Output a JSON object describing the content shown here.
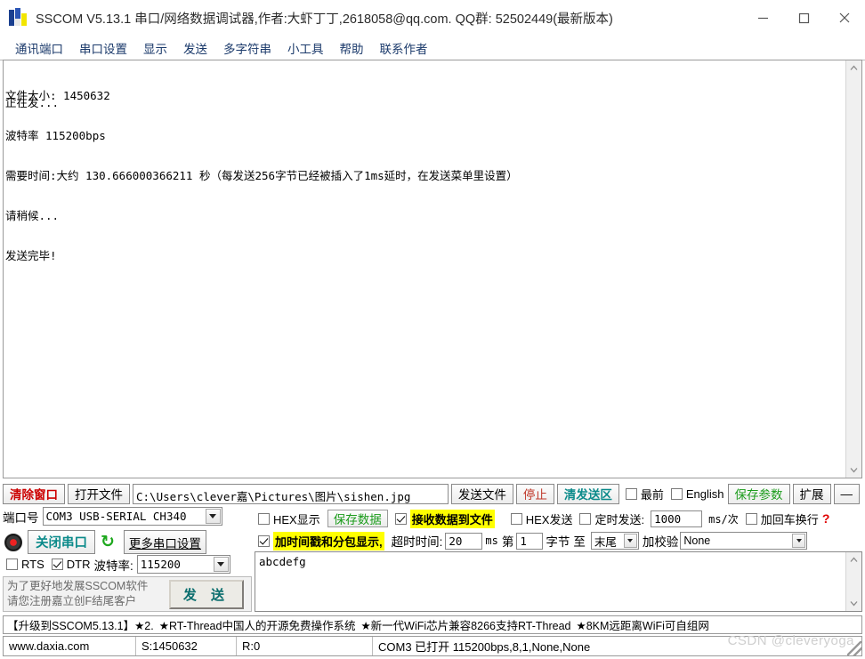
{
  "window": {
    "title": "SSCOM V5.13.1 串口/网络数据调试器,作者:大虾丁丁,2618058@qq.com. QQ群: 52502449(最新版本)",
    "minimize_label": "—",
    "maximize_label": "□",
    "close_label": "✕",
    "icon": "sscom-app-icon"
  },
  "menu": {
    "items": [
      {
        "label": "通讯端口"
      },
      {
        "label": "串口设置"
      },
      {
        "label": "显示"
      },
      {
        "label": "发送"
      },
      {
        "label": "多字符串"
      },
      {
        "label": "小工具"
      },
      {
        "label": "帮助"
      },
      {
        "label": "联系作者"
      }
    ]
  },
  "receive": {
    "lines": [
      "文件大小: 1450632",
      "波特率 115200bps",
      "需要时间:大约 130.666000366211 秒（每发送256字节已经被插入了1ms延时，在发送菜单里设置）",
      "请稍候...",
      "发送完毕!"
    ],
    "overlap_line": "正在发..."
  },
  "toolbar": {
    "clear_window": "清除窗口",
    "open_file": "打开文件",
    "file_path": "C:\\Users\\clever嘉\\Pictures\\图片\\sishen.jpg",
    "send_file": "发送文件",
    "stop": "停止",
    "clear_send": "清发送区",
    "topmost_label": "最前",
    "topmost_checked": false,
    "english_label": "English",
    "english_checked": false,
    "save_params": "保存参数",
    "extend": "扩展",
    "collapse": "—"
  },
  "port_panel": {
    "port_label": "端口号",
    "port_value": "COM3 USB-SERIAL CH340",
    "close_port_button": "关闭串口",
    "refresh_icon": "refresh-icon",
    "more_settings": "更多串口设置",
    "rts_label": "RTS",
    "rts_checked": false,
    "dtr_label": "DTR",
    "dtr_checked": true,
    "baud_label": "波特率:",
    "baud_value": "115200",
    "register_line1": "为了更好地发展SSCOM软件",
    "register_line2": "请您注册嘉立创F结尾客户",
    "send_button": "发 送"
  },
  "options_row1": {
    "hex_display_label": "HEX显示",
    "hex_display_checked": false,
    "save_data": "保存数据",
    "recv_to_file_label": "接收数据到文件",
    "recv_to_file_checked": true,
    "hex_send_label": "HEX发送",
    "hex_send_checked": false,
    "timed_send_label": "定时发送:",
    "timed_send_checked": false,
    "timed_send_value": "1000",
    "timed_send_unit": "ms/次",
    "add_crlf_label": "加回车换行",
    "add_crlf_checked": false,
    "help_mark": "?"
  },
  "options_row2": {
    "timestamp_label": "加时间戳和分包显示,",
    "timestamp_checked": true,
    "timeout_label": "超时时间:",
    "timeout_value": "20",
    "timeout_unit": "ms",
    "byte_prefix": "第",
    "byte_index": "1",
    "byte_label": "字节",
    "to_label": "至",
    "to_value": "末尾",
    "checksum_label": "加校验",
    "checksum_value": "None"
  },
  "send_area": {
    "text": "abcdefg"
  },
  "ad_bar": {
    "segments": [
      "【升级到SSCOM5.13.1】★2.",
      "★RT-Thread中国人的开源免费操作系统",
      "★新一代WiFi芯片兼容8266支持RT-Thread",
      "★8KM远距离WiFi可自组网"
    ]
  },
  "status_bar": {
    "site": "www.daxia.com",
    "sent": "S:1450632",
    "received": "R:0",
    "connection": "COM3 已打开  115200bps,8,1,None,None"
  },
  "watermark": "CSDN @cleveryoga",
  "colors": {
    "accent_red": "#cc0000",
    "accent_teal": "#0b8a8a",
    "accent_green": "#1c9c1c",
    "highlight_yellow": "#ffff00",
    "menu_blue": "#1b3a6b"
  }
}
